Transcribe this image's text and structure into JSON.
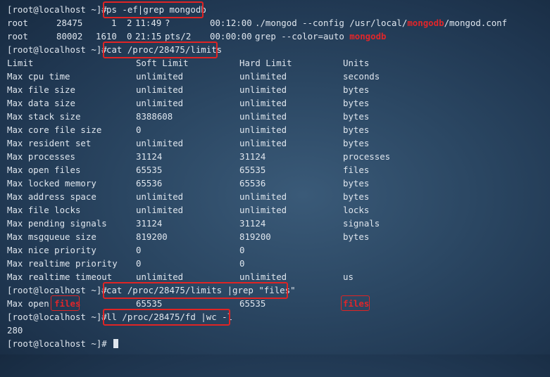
{
  "prompt": "[root@localhost ~]# ",
  "commands": {
    "ps": "ps -ef|grep mongodb",
    "cat_limits": "cat /proc/28475/limits",
    "cat_grep": "cat /proc/28475/limits |grep \"files\"",
    "ll": "ll /proc/28475/fd |wc -l"
  },
  "ps_output": [
    {
      "user": "root",
      "pid": "28475",
      "ppid": "1",
      "c": "2",
      "stime": "11:49",
      "tty": "?",
      "time": "00:12:00",
      "cmd_pre": "./mongod --config /usr/local/",
      "cmd_hl": "mongodb",
      "cmd_post": "/mongod.conf"
    },
    {
      "user": "root",
      "pid": "80002",
      "ppid": "1610",
      "c": "0",
      "stime": "21:15",
      "tty": "pts/2",
      "time": "00:00:00",
      "cmd_pre": "grep --color=auto ",
      "cmd_hl": "mongodb",
      "cmd_post": ""
    }
  ],
  "limits_header": {
    "limit": "Limit",
    "soft": "Soft Limit",
    "hard": "Hard Limit",
    "units": "Units"
  },
  "limits": [
    {
      "limit": "Max cpu time",
      "soft": "unlimited",
      "hard": "unlimited",
      "units": "seconds"
    },
    {
      "limit": "Max file size",
      "soft": "unlimited",
      "hard": "unlimited",
      "units": "bytes"
    },
    {
      "limit": "Max data size",
      "soft": "unlimited",
      "hard": "unlimited",
      "units": "bytes"
    },
    {
      "limit": "Max stack size",
      "soft": "8388608",
      "hard": "unlimited",
      "units": "bytes"
    },
    {
      "limit": "Max core file size",
      "soft": "0",
      "hard": "unlimited",
      "units": "bytes"
    },
    {
      "limit": "Max resident set",
      "soft": "unlimited",
      "hard": "unlimited",
      "units": "bytes"
    },
    {
      "limit": "Max processes",
      "soft": "31124",
      "hard": "31124",
      "units": "processes"
    },
    {
      "limit": "Max open files",
      "soft": "65535",
      "hard": "65535",
      "units": "files"
    },
    {
      "limit": "Max locked memory",
      "soft": "65536",
      "hard": "65536",
      "units": "bytes"
    },
    {
      "limit": "Max address space",
      "soft": "unlimited",
      "hard": "unlimited",
      "units": "bytes"
    },
    {
      "limit": "Max file locks",
      "soft": "unlimited",
      "hard": "unlimited",
      "units": "locks"
    },
    {
      "limit": "Max pending signals",
      "soft": "31124",
      "hard": "31124",
      "units": "signals"
    },
    {
      "limit": "Max msgqueue size",
      "soft": "819200",
      "hard": "819200",
      "units": "bytes"
    },
    {
      "limit": "Max nice priority",
      "soft": "0",
      "hard": "0",
      "units": ""
    },
    {
      "limit": "Max realtime priority",
      "soft": "0",
      "hard": "0",
      "units": ""
    },
    {
      "limit": "Max realtime timeout",
      "soft": "unlimited",
      "hard": "unlimited",
      "units": "us"
    }
  ],
  "grep_result": {
    "limit_pre": "Max open ",
    "limit_hl": "files",
    "soft": "65535",
    "hard": "65535",
    "units_hl": "files"
  },
  "fd_count": "280",
  "colors": {
    "background": "#2b4763",
    "text": "#dfe6ee",
    "highlight": "#e0262a",
    "box": "#e02424"
  }
}
